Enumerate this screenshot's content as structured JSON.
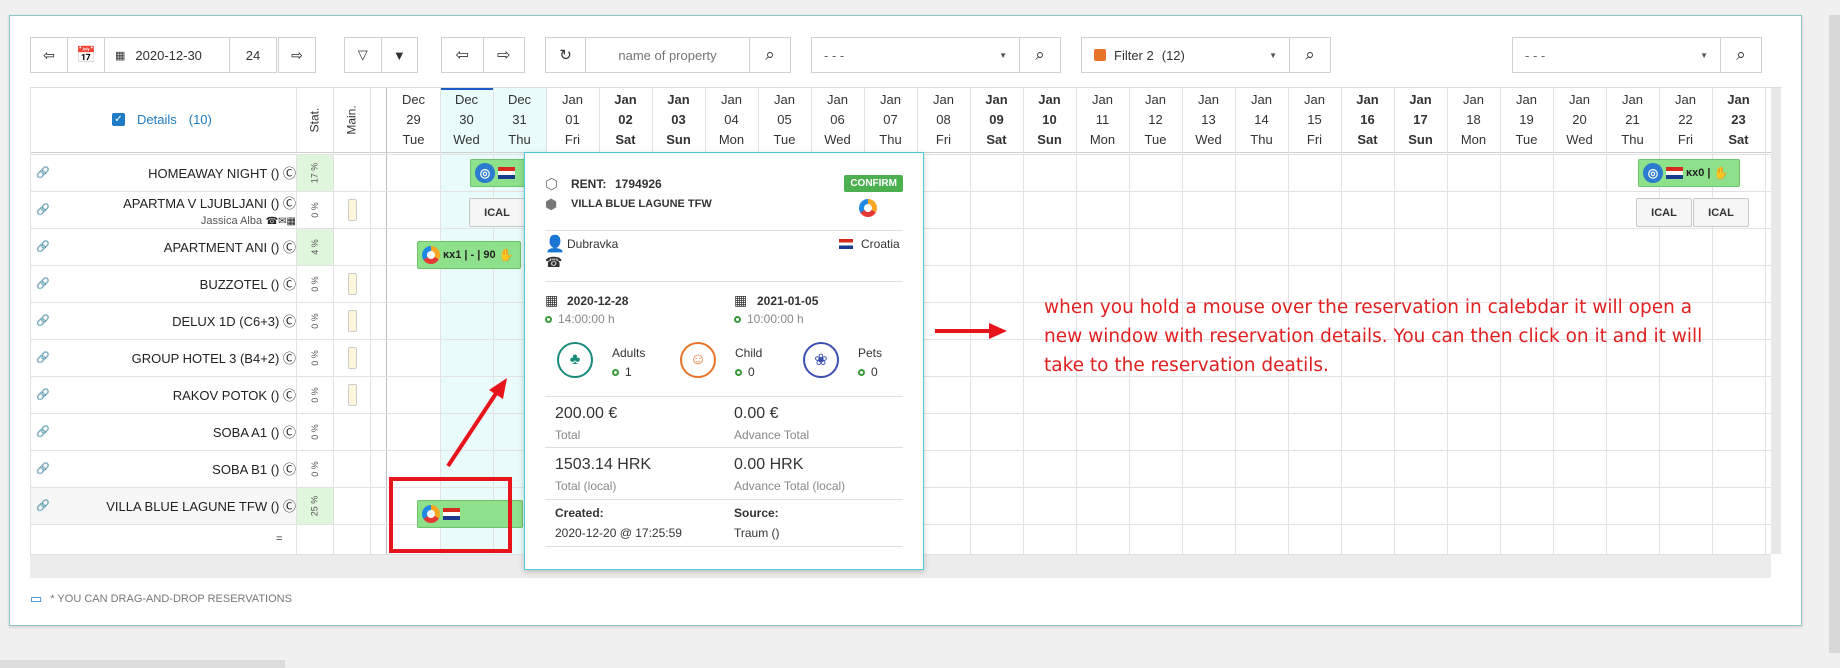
{
  "toolbar": {
    "date": "2020-12-30",
    "days": "24",
    "search_placeholder": "name of property",
    "select1": "- - -",
    "filter_label": "Filter 2",
    "filter_count": "(12)",
    "select2": "- - -"
  },
  "header": {
    "details_label": "Details",
    "details_count": "(10)",
    "stat_label": "Stat.",
    "main_label": "Main."
  },
  "days": [
    {
      "month": "Dec",
      "day": "29",
      "wd": "Tue"
    },
    {
      "month": "Dec",
      "day": "30",
      "wd": "Wed"
    },
    {
      "month": "Dec",
      "day": "31",
      "wd": "Thu"
    },
    {
      "month": "Jan",
      "day": "01",
      "wd": "Fri"
    },
    {
      "month": "Jan",
      "day": "02",
      "wd": "Sat"
    },
    {
      "month": "Jan",
      "day": "03",
      "wd": "Sun"
    },
    {
      "month": "Jan",
      "day": "04",
      "wd": "Mon"
    },
    {
      "month": "Jan",
      "day": "05",
      "wd": "Tue"
    },
    {
      "month": "Jan",
      "day": "06",
      "wd": "Wed"
    },
    {
      "month": "Jan",
      "day": "07",
      "wd": "Thu"
    },
    {
      "month": "Jan",
      "day": "08",
      "wd": "Fri"
    },
    {
      "month": "Jan",
      "day": "09",
      "wd": "Sat"
    },
    {
      "month": "Jan",
      "day": "10",
      "wd": "Sun"
    },
    {
      "month": "Jan",
      "day": "11",
      "wd": "Mon"
    },
    {
      "month": "Jan",
      "day": "12",
      "wd": "Tue"
    },
    {
      "month": "Jan",
      "day": "13",
      "wd": "Wed"
    },
    {
      "month": "Jan",
      "day": "14",
      "wd": "Thu"
    },
    {
      "month": "Jan",
      "day": "15",
      "wd": "Fri"
    },
    {
      "month": "Jan",
      "day": "16",
      "wd": "Sat"
    },
    {
      "month": "Jan",
      "day": "17",
      "wd": "Sun"
    },
    {
      "month": "Jan",
      "day": "18",
      "wd": "Mon"
    },
    {
      "month": "Jan",
      "day": "19",
      "wd": "Tue"
    },
    {
      "month": "Jan",
      "day": "20",
      "wd": "Wed"
    },
    {
      "month": "Jan",
      "day": "21",
      "wd": "Thu"
    },
    {
      "month": "Jan",
      "day": "22",
      "wd": "Fri"
    },
    {
      "month": "Jan",
      "day": "23",
      "wd": "Sat"
    }
  ],
  "properties": [
    {
      "name": "HOMEAWAY NIGHT ()",
      "stat": "17 %",
      "main": false
    },
    {
      "name": "APARTMA V LJUBLJANI ()",
      "sub": "Jassica Alba",
      "stat": "0 %",
      "main": true
    },
    {
      "name": "APARTMENT ANI ()",
      "stat": "4 %",
      "main": false
    },
    {
      "name": "BUZZOTEL ()",
      "stat": "0 %",
      "main": true
    },
    {
      "name": "DELUX 1D (C6+3)",
      "stat": "0 %",
      "main": true
    },
    {
      "name": "GROUP HOTEL 3 (B4+2)",
      "stat": "0 %",
      "main": true
    },
    {
      "name": "RAKOV POTOK ()",
      "stat": "0 %",
      "main": true
    },
    {
      "name": "SOBA A1 ()",
      "stat": "0 %",
      "main": false
    },
    {
      "name": "SOBA B1 ()",
      "stat": "0 %",
      "main": false
    },
    {
      "name": "VILLA BLUE LAGUNE TFW ()",
      "stat": "25 %",
      "main": false
    }
  ],
  "grid_footer": "=",
  "reservations": {
    "ani_label": "ĸx1 | - | 90",
    "right_label": "ĸx0 |",
    "ical": "ICAL"
  },
  "popup": {
    "rent_label": "RENT:",
    "rent_id": "1794926",
    "confirm": "CONFIRM",
    "property": "VILLA BLUE LAGUNE TFW",
    "guest": "Dubravka",
    "country": "Croatia",
    "checkin_date": "2020-12-28",
    "checkin_time": "14:00:00 h",
    "checkout_date": "2021-01-05",
    "checkout_time": "10:00:00 h",
    "adults_label": "Adults",
    "adults": "1",
    "child_label": "Child",
    "child": "0",
    "pets_label": "Pets",
    "pets": "0",
    "total": "200.00 €",
    "total_label": "Total",
    "advance": "0.00 €",
    "advance_label": "Advance Total",
    "total_local": "1503.14 HRK",
    "total_local_label": "Total (local)",
    "advance_local": "0.00 HRK",
    "advance_local_label": "Advance Total (local)",
    "created_label": "Created:",
    "created": "2020-12-20 @ 17:25:59",
    "source_label": "Source:",
    "source": "Traum ()"
  },
  "annotation": "when you hold a mouse over the reservation in calebdar it will open a new window with reservation details. You can then click on it and it will take to the reservation deatils.",
  "footer_hint": "* YOU CAN DRAG-AND-DROP RESERVATIONS",
  "colors": {
    "accent": "#1e7bc4",
    "reservation": "#8ee08a",
    "annotation": "#e02020",
    "today": "#e8f9fb"
  }
}
